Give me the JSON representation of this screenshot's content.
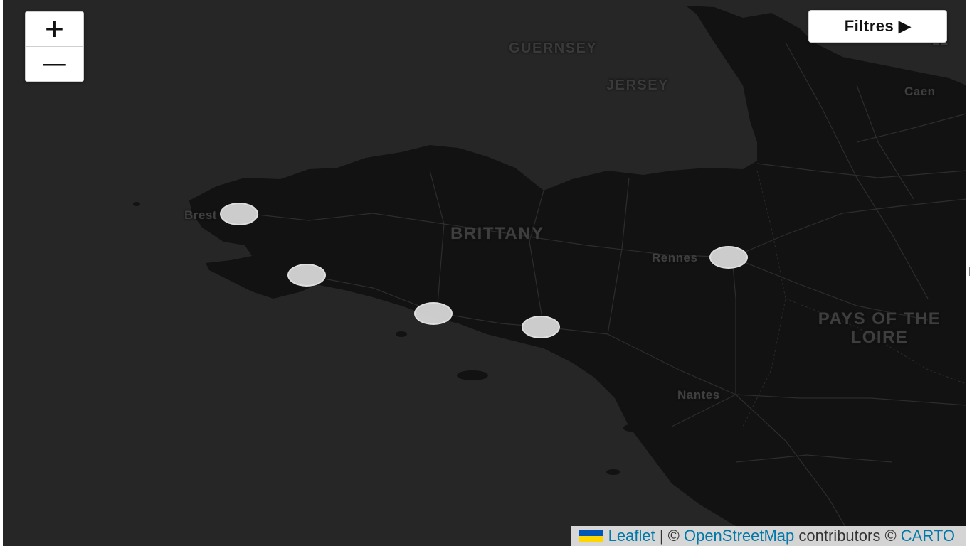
{
  "map": {
    "tiles": "dark",
    "colors": {
      "sea": "#262626",
      "land": "#111111",
      "roads": "#2e2e2e",
      "marker_fill": "#d6d6d6",
      "marker_border": "#eaeaea",
      "link": "#0078a8"
    }
  },
  "zoom": {
    "in_label": "+",
    "out_label": "—"
  },
  "filters": {
    "label": "Filtres ▶"
  },
  "labels": {
    "guernsey": "GUERNSEY",
    "jersey": "JERSEY",
    "caen": "Caen",
    "brittany": "BRITTANY",
    "brest": "Brest",
    "rennes": "Rennes",
    "pays_line1": "PAYS OF THE",
    "pays_line2": "LOIRE",
    "nantes": "Nantes",
    "le_edge": "LE"
  },
  "markers": [
    {
      "id": "brest"
    },
    {
      "id": "crozon"
    },
    {
      "id": "lorient"
    },
    {
      "id": "vannes"
    },
    {
      "id": "rennes"
    }
  ],
  "attribution": {
    "leaflet": "Leaflet",
    "sep": " | © ",
    "osm": "OpenStreetMap",
    "contributors": " contributors © ",
    "carto": "CARTO"
  }
}
